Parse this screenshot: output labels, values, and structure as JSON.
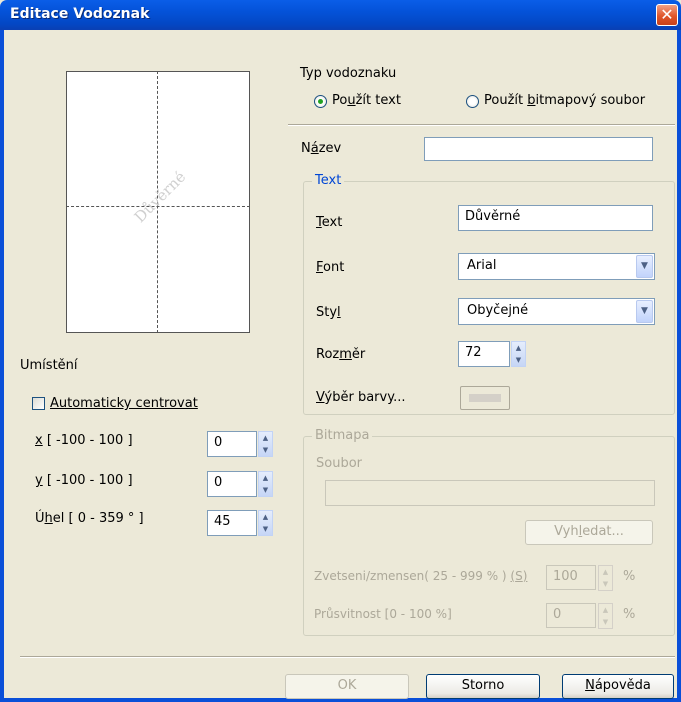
{
  "window": {
    "title": "Editace Vodoznak",
    "close_glyph": "✕"
  },
  "preview": {
    "watermark_text": "Důvěrné"
  },
  "placement": {
    "heading": "Umístění",
    "auto_center": {
      "label": "Automaticky centrovat",
      "checked": false
    },
    "x": {
      "label_key": "x",
      "label_rest": " [ -100  -  100 ]",
      "value": "0"
    },
    "y": {
      "label_key": "y",
      "label_rest": " [ -100  -  100 ]",
      "value": "0"
    },
    "angle": {
      "label_pre": "Ú",
      "label_key": "h",
      "label_rest": "el [ 0 - 359 ° ]",
      "value": "45"
    }
  },
  "type": {
    "heading": "Typ vodoznaku",
    "use_text": {
      "pre": "Po",
      "key": "u",
      "rest": "žít text",
      "selected": true
    },
    "use_bitmap": {
      "pre": "Použít ",
      "key": "b",
      "rest": "itmapový soubor",
      "selected": false
    }
  },
  "name": {
    "pre": "N",
    "key": "á",
    "rest": "zev",
    "value": ""
  },
  "text_group": {
    "legend": "Text",
    "text": {
      "key": "T",
      "rest": "ext",
      "value": "Důvěrné"
    },
    "font": {
      "key": "F",
      "rest": "ont",
      "value": "Arial"
    },
    "style": {
      "pre": "Sty",
      "key": "l",
      "value": "Obyčejné"
    },
    "size": {
      "pre": "Roz",
      "key": "m",
      "rest": "ěr",
      "value": "72"
    },
    "color": {
      "key": "V",
      "rest": "ýběr barvy..."
    }
  },
  "bitmap_group": {
    "legend": "Bitmapa",
    "file_label": "Soubor",
    "file_value": "",
    "browse": {
      "pre": "Vyh",
      "key": "l",
      "rest": "edat..."
    },
    "scale": {
      "label": "Zvetseni/zmensen(  25 - 999 %  )",
      "key": "S",
      "value": "100",
      "unit": "%"
    },
    "transparency": {
      "label": "Průsvitnost [0 - 100 %]",
      "value": "0",
      "unit": "%"
    }
  },
  "footer": {
    "ok": "OK",
    "cancel": "Storno",
    "help": {
      "key": "N",
      "rest": "ápověda"
    }
  }
}
